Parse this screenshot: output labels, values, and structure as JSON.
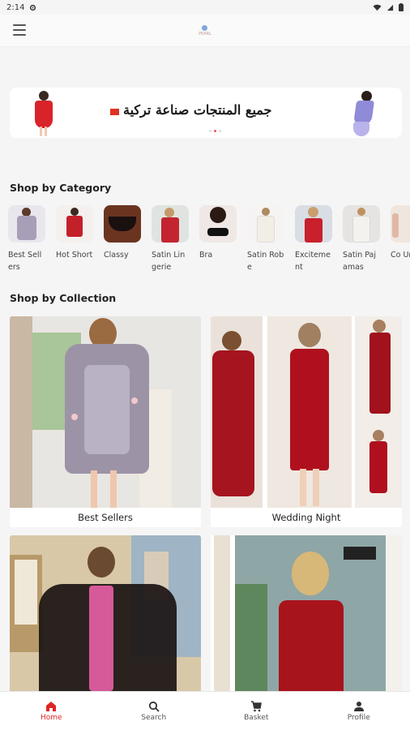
{
  "status_bar": {
    "time": "2:14"
  },
  "logo": {
    "text": "PEARL"
  },
  "banner": {
    "text": "جميع المنتجات صناعة تركية",
    "slide_count": 3,
    "active_slide": 1
  },
  "shop_by_category": {
    "title": "Shop by Category",
    "items": [
      {
        "label": "Best Sellers"
      },
      {
        "label": "Hot Short"
      },
      {
        "label": "Classy"
      },
      {
        "label": "Satin Lingerie"
      },
      {
        "label": "Bra"
      },
      {
        "label": "Satin Robe"
      },
      {
        "label": "Excitement"
      },
      {
        "label": "Satin Pajamas"
      },
      {
        "label": "Co Un"
      }
    ]
  },
  "shop_by_collection": {
    "title": "Shop by Collection",
    "items": [
      {
        "label": "Best Sellers"
      },
      {
        "label": "Wedding Night"
      },
      {
        "label": ""
      },
      {
        "label": ""
      }
    ]
  },
  "bottom_nav": {
    "items": [
      {
        "label": "Home",
        "icon": "home-icon",
        "active": true
      },
      {
        "label": "Search",
        "icon": "search-icon",
        "active": false
      },
      {
        "label": "Basket",
        "icon": "basket-icon",
        "active": false
      },
      {
        "label": "Profile",
        "icon": "profile-icon",
        "active": false
      }
    ]
  },
  "colors": {
    "accent": "#e02424",
    "background": "#f5f5f5"
  }
}
